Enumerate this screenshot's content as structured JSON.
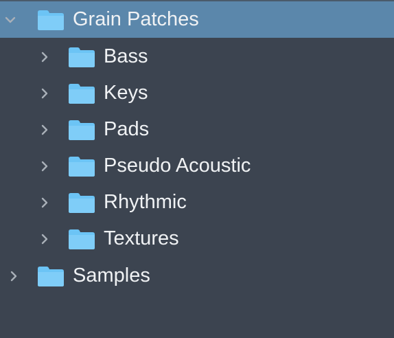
{
  "tree": {
    "root": {
      "label": "Grain Patches",
      "expanded": true,
      "selected": true,
      "children": [
        {
          "label": "Bass"
        },
        {
          "label": "Keys"
        },
        {
          "label": "Pads"
        },
        {
          "label": "Pseudo Acoustic"
        },
        {
          "label": "Rhythmic"
        },
        {
          "label": "Textures"
        }
      ]
    },
    "sibling": {
      "label": "Samples",
      "expanded": false
    }
  },
  "colors": {
    "background": "#3c4450",
    "selection": "#5b87ab",
    "folder": "#6cc4f5",
    "text": "#f0f2f4",
    "chevron": "#a9b0b8"
  },
  "icons": {
    "expand": "chevron-down-icon",
    "collapse": "chevron-right-icon",
    "folder": "folder-icon"
  }
}
